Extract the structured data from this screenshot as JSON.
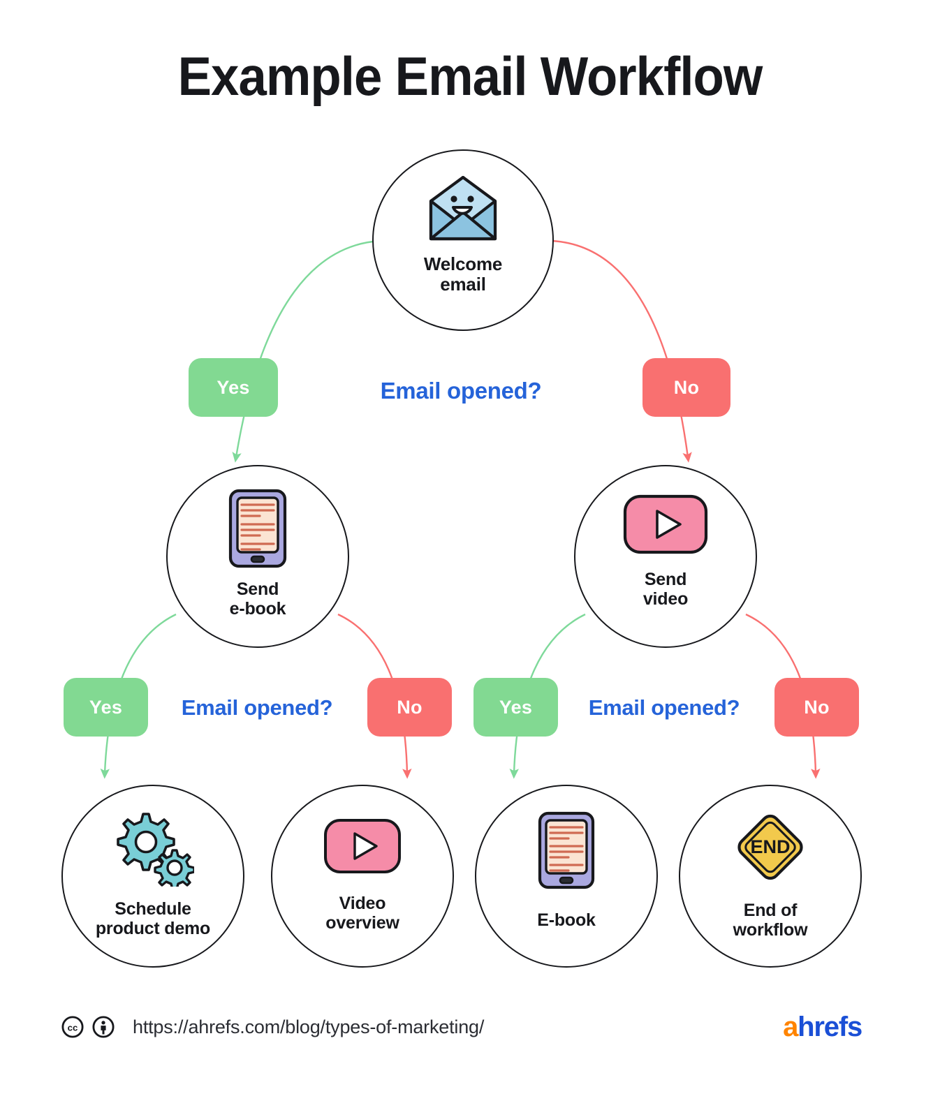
{
  "page": {
    "title": "Example Email Workflow",
    "background": "#ffffff"
  },
  "colors": {
    "yes_badge": "#82d992",
    "no_badge": "#f97070",
    "question_text": "#2563d9",
    "node_outline": "#17181c",
    "edge_yes": "#7ed99a",
    "edge_no": "#f97070",
    "envelope_flap": "#bfe0f2",
    "envelope_body": "#8cc3e0",
    "tablet_frame": "#aaa8e0",
    "tablet_screen": "#fbe4d3",
    "tablet_lines": "#cf6a52",
    "video_pink": "#f58ca8",
    "gear_teal": "#79ced6",
    "end_yellow": "#f2c94c",
    "logo_orange": "#ff8400",
    "logo_blue": "#1a4fd6"
  },
  "nodes": [
    {
      "id": "welcome-email",
      "icon": "open-envelope-smile-icon",
      "label_line1": "Welcome",
      "label_line2": "email"
    },
    {
      "id": "send-ebook",
      "icon": "tablet-ebook-icon",
      "label_line1": "Send",
      "label_line2": "e-book"
    },
    {
      "id": "send-video",
      "icon": "video-play-icon",
      "label_line1": "Send",
      "label_line2": "video"
    },
    {
      "id": "schedule-product-demo",
      "icon": "gears-icon",
      "label_line1": "Schedule",
      "label_line2": "product demo"
    },
    {
      "id": "video-overview",
      "icon": "video-play-icon",
      "label_line1": "Video",
      "label_line2": "overview"
    },
    {
      "id": "ebook",
      "icon": "tablet-ebook-icon",
      "label_line1": "E-book",
      "label_line2": ""
    },
    {
      "id": "end-of-workflow",
      "icon": "end-sign-icon",
      "label_line1": "End of",
      "label_line2": "workflow"
    }
  ],
  "decisions": [
    {
      "id": "decision-1",
      "question": "Email opened?",
      "yes_label": "Yes",
      "no_label": "No"
    },
    {
      "id": "decision-2",
      "question": "Email opened?",
      "yes_label": "Yes",
      "no_label": "No"
    },
    {
      "id": "decision-3",
      "question": "Email opened?",
      "yes_label": "Yes",
      "no_label": "No"
    }
  ],
  "end_sign_text": "END",
  "footer": {
    "url": "https://ahrefs.com/blog/types-of-marketing/",
    "license_icons": [
      "creative-commons-icon",
      "creative-commons-by-icon"
    ],
    "logo_first": "a",
    "logo_rest": "hrefs"
  },
  "chart_data": {
    "type": "diagram",
    "title": "Example Email Workflow",
    "flow": [
      {
        "from": "welcome-email",
        "to": "send-ebook",
        "branch": "Yes",
        "question": "Email opened?"
      },
      {
        "from": "welcome-email",
        "to": "send-video",
        "branch": "No",
        "question": "Email opened?"
      },
      {
        "from": "send-ebook",
        "to": "schedule-product-demo",
        "branch": "Yes",
        "question": "Email opened?"
      },
      {
        "from": "send-ebook",
        "to": "video-overview",
        "branch": "No",
        "question": "Email opened?"
      },
      {
        "from": "send-video",
        "to": "ebook",
        "branch": "Yes",
        "question": "Email opened?"
      },
      {
        "from": "send-video",
        "to": "end-of-workflow",
        "branch": "No",
        "question": "Email opened?"
      }
    ]
  }
}
